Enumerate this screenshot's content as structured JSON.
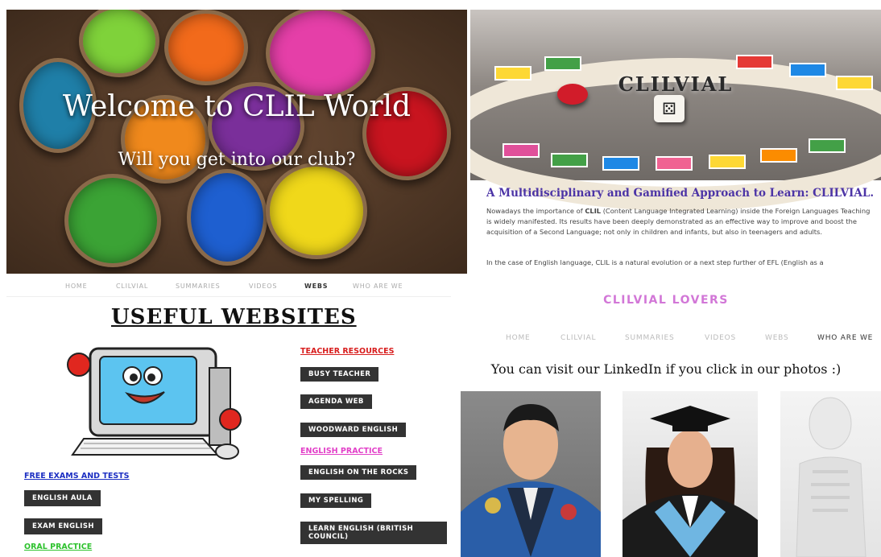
{
  "hero": {
    "title": "Welcome to CLIL World",
    "subtitle": "Will you get into our club?",
    "powder_colors": [
      "#7fd23a",
      "#f26a1b",
      "#e53fa8",
      "#1f7fa8",
      "#f0891c",
      "#7a2f9a",
      "#c8141f",
      "#3ba335",
      "#1e5fd0",
      "#f0d81a"
    ]
  },
  "blog": {
    "banner_title": "CLILVIAL",
    "die_face": "⚄",
    "post_title": "A Multidisciplinary and Gamified Approach to Learn: CLILVIAL.",
    "p1_before": "Nowadays the importance of ",
    "p1_bold": "CLIL",
    "p1_after": " (Content Language Integrated Learning) inside the Foreign Languages Teaching is widely manifested. Its results have been deeply demonstrated as an effective way to improve and boost the acquisition of a Second Language; not only in children and infants, but also in teenagers and adults.",
    "p2": "In the case of English language, CLIL is a natural evolution or a next step further of EFL (English as a"
  },
  "websites": {
    "nav": [
      "HOME",
      "CLILVIAL",
      "SUMMARIES",
      "VIDEOS",
      "WEBS",
      "WHO ARE WE"
    ],
    "nav_active": "WEBS",
    "heading": "USEFUL WEBSITES",
    "teacher_resources": "TEACHER RESOURCES",
    "busy_teacher": "BUSY TEACHER",
    "agenda_web": "AGENDA WEB",
    "woodward": "WOODWARD ENGLISH",
    "english_practice": "ENGLISH PRACTICE",
    "on_the_rocks": "ENGLISH ON THE ROCKS",
    "my_spelling": "MY SPELLING",
    "learn_english": "LEARN ENGLISH (BRITISH COUNCIL)",
    "free_exams": "FREE EXAMS AND TESTS",
    "english_aula": "ENGLISH AULA",
    "exam_english": "EXAM ENGLISH",
    "oral_practice": "ORAL PRACTICE",
    "colors": {
      "teacher": "#d81e1e",
      "practice": "#e23fc8",
      "exams": "#1c2fc2",
      "oral": "#2ec22e",
      "button": "#333333"
    }
  },
  "lovers": {
    "title": "CLILVIAL LOVERS",
    "nav": [
      "HOME",
      "CLILVIAL",
      "SUMMARIES",
      "VIDEOS",
      "WEBS",
      "WHO ARE WE"
    ],
    "nav_active": "WHO ARE WE",
    "linkedin_text": "You can visit our LinkedIn if you click in our photos :)"
  }
}
